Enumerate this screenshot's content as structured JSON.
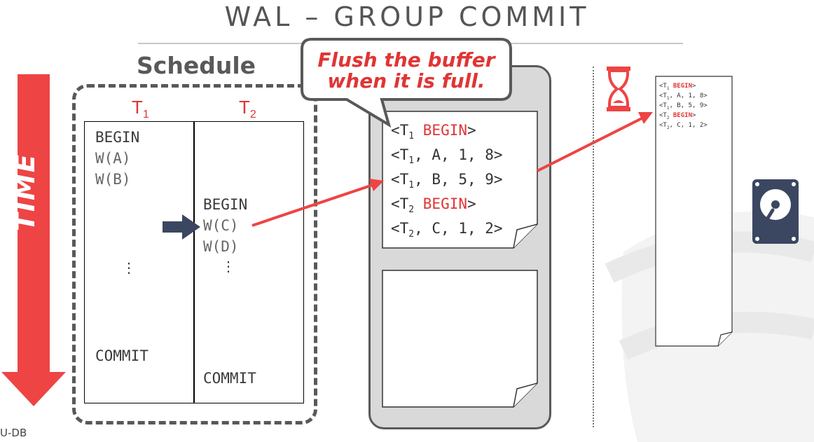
{
  "slide": {
    "title": "WAL – GROUP COMMIT",
    "footer": "U-DB"
  },
  "schedule": {
    "title": "Schedule",
    "time_label": "TIME",
    "t1_header": {
      "base": "T",
      "sub": "1"
    },
    "t2_header": {
      "base": "T",
      "sub": "2"
    },
    "t1_ops": [
      "BEGIN",
      "W(A)",
      "W(B)",
      "⋮",
      "COMMIT"
    ],
    "t2_ops": [
      "BEGIN",
      "W(C)",
      "W(D)",
      "⋮",
      "COMMIT"
    ]
  },
  "callout": {
    "line1": "Flush the buffer",
    "line2": "when it is full."
  },
  "buffer": {
    "page1_lines": [
      {
        "open": "<T",
        "sub": "1",
        "rest": "",
        "keyword": "BEGIN",
        "close": ">"
      },
      {
        "open": "<T",
        "sub": "1",
        "rest": ", A, 1, 8>",
        "keyword": "",
        "close": ""
      },
      {
        "open": "<T",
        "sub": "1",
        "rest": ", B, 5, 9>",
        "keyword": "",
        "close": ""
      },
      {
        "open": "<T",
        "sub": "2",
        "rest": "",
        "keyword": "BEGIN",
        "close": ">"
      },
      {
        "open": "<T",
        "sub": "2",
        "rest": ", C, 1, 2>",
        "keyword": "",
        "close": ""
      }
    ]
  },
  "disk_log": {
    "lines": [
      {
        "open": "<T",
        "sub": "1",
        "rest": "",
        "keyword": "BEGIN",
        "close": ">"
      },
      {
        "open": "<T",
        "sub": "1",
        "rest": ", A, 1, 8>",
        "keyword": "",
        "close": ""
      },
      {
        "open": "<T",
        "sub": "1",
        "rest": ", B, 5, 9>",
        "keyword": "",
        "close": ""
      },
      {
        "open": "<T",
        "sub": "2",
        "rest": "",
        "keyword": "BEGIN",
        "close": ">"
      },
      {
        "open": "<T",
        "sub": "2",
        "rest": ", C, 1, 2>",
        "keyword": "",
        "close": ""
      }
    ]
  },
  "icons": {
    "hourglass": "hourglass-icon",
    "disk": "hard-disk-icon",
    "pointer": "pointer-arrow-icon"
  },
  "colors": {
    "accent_red": "#e03535",
    "arrow_red": "#ee4444",
    "navy": "#3b4660",
    "gray": "#595959"
  }
}
